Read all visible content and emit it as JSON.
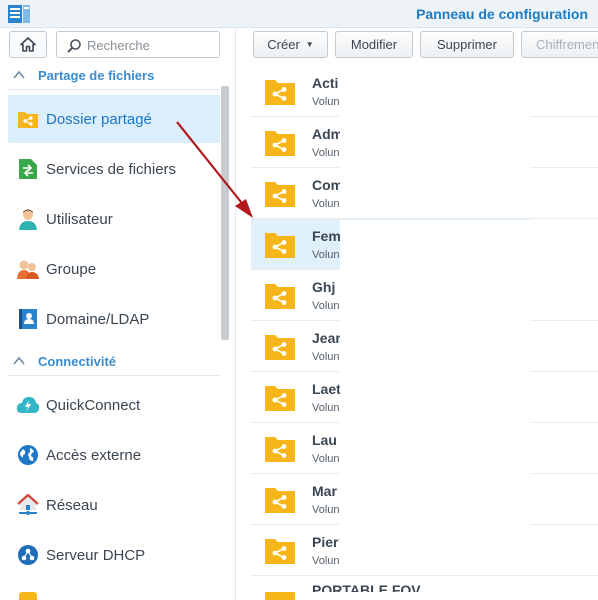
{
  "window": {
    "title": "Panneau de configuration",
    "logo_icon": "dsm-logo-icon"
  },
  "sidebar": {
    "home_icon": "home-icon",
    "search": {
      "placeholder": "Recherche",
      "value": ""
    },
    "sections": [
      {
        "label": "Partage de fichiers",
        "items": [
          {
            "label": "Dossier partagé",
            "icon": "shared-folder-icon",
            "active": true
          },
          {
            "label": "Services de fichiers",
            "icon": "file-services-icon",
            "active": false
          },
          {
            "label": "Utilisateur",
            "icon": "user-icon",
            "active": false
          },
          {
            "label": "Groupe",
            "icon": "group-icon",
            "active": false
          },
          {
            "label": "Domaine/LDAP",
            "icon": "domain-ldap-icon",
            "active": false
          }
        ]
      },
      {
        "label": "Connectivité",
        "items": [
          {
            "label": "QuickConnect",
            "icon": "quickconnect-icon",
            "active": false
          },
          {
            "label": "Accès externe",
            "icon": "external-access-icon",
            "active": false
          },
          {
            "label": "Réseau",
            "icon": "network-icon",
            "active": false
          },
          {
            "label": "Serveur DHCP",
            "icon": "dhcp-server-icon",
            "active": false
          }
        ]
      }
    ]
  },
  "toolbar": {
    "create_label": "Créer",
    "modify_label": "Modifier",
    "delete_label": "Supprimer",
    "encrypt_label": "Chiffremen"
  },
  "folders": [
    {
      "name": "Acti",
      "sub": "Volun",
      "selected": false
    },
    {
      "name": "Adm",
      "sub": "Volun",
      "selected": false
    },
    {
      "name": "Com",
      "sub": "Volun",
      "selected": false
    },
    {
      "name": "Fem",
      "sub": "Volun",
      "selected": true
    },
    {
      "name": "Ghj",
      "sub": "Volun",
      "selected": false
    },
    {
      "name": "Jear",
      "sub": "Volun",
      "selected": false
    },
    {
      "name": "Laet",
      "sub": "Volun",
      "selected": false
    },
    {
      "name": "Lau",
      "sub": "Volun",
      "selected": false
    },
    {
      "name": "Mar",
      "sub": "Volun",
      "selected": false
    },
    {
      "name": "Pier",
      "sub": "Volun",
      "selected": false
    }
  ],
  "partial_last_row": "PORTABLE FOV",
  "colors": {
    "accent": "#1e7cc4",
    "active_bg": "#dbeefb",
    "folder": "#f6b619",
    "arrow": "#b3191c"
  }
}
